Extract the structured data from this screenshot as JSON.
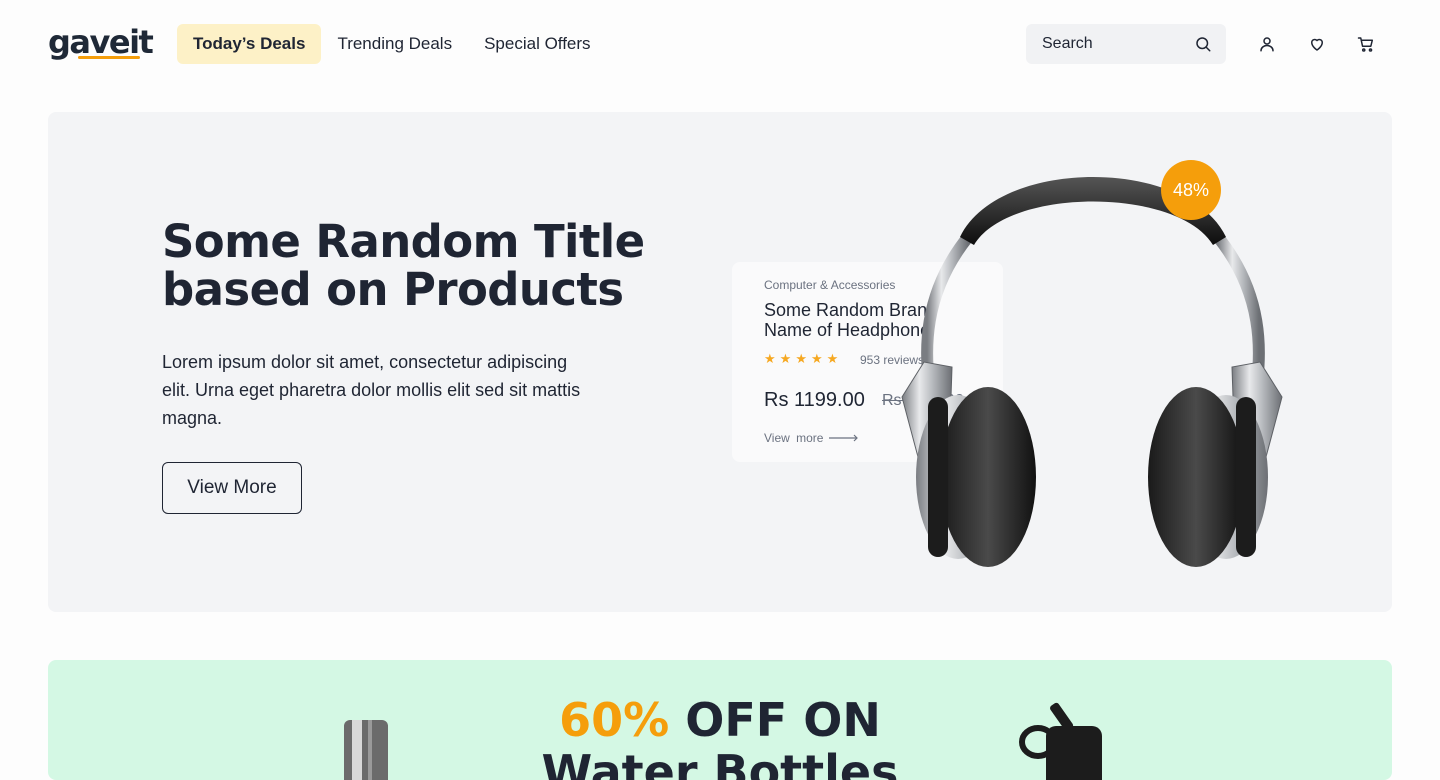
{
  "header": {
    "logo_text": "gaveit",
    "nav": [
      {
        "label": "Today’s Deals",
        "active": true
      },
      {
        "label": "Trending Deals",
        "active": false
      },
      {
        "label": "Special Offers",
        "active": false
      }
    ],
    "search_placeholder": "Search"
  },
  "icons": {
    "search": "search-icon",
    "account": "user-icon",
    "wishlist": "heart-icon",
    "cart": "cart-icon"
  },
  "hero": {
    "title": "Some Random Title based on Products",
    "description": "Lorem ipsum dolor sit amet, consectetur adipiscing elit. Urna eget pharetra dolor mollis elit sed sit mattis magna.",
    "cta_label": "View More"
  },
  "product_card": {
    "category": "Computer & Accessories",
    "name": "Some Random Brand Name of Headphone",
    "rating": 5,
    "reviews": "953 reviews",
    "price": "Rs 1199.00",
    "old_price": "Rs 1999.00",
    "link_label": "View more"
  },
  "discount_badge": "48%",
  "promo": {
    "accent": "60%",
    "title_rest": " OFF ON",
    "title_line2": "Water Bottles"
  },
  "colors": {
    "accent": "#f59e0b",
    "active_nav_bg": "#fdf1c7",
    "hero_bg": "#f3f4f6",
    "promo_bg": "#d4f8e4",
    "text": "#1f2533"
  }
}
